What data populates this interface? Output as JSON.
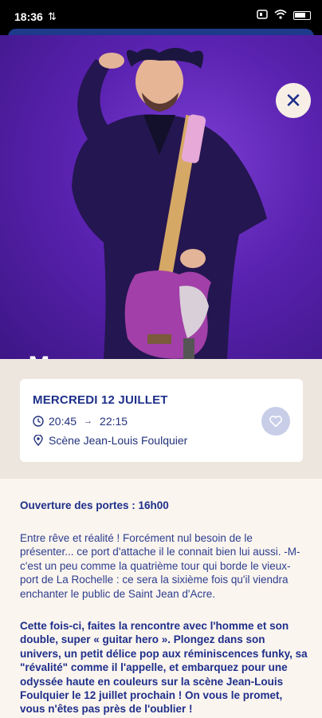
{
  "status_bar": {
    "time": "18:36",
    "data_icon": "⇅"
  },
  "hero": {
    "artist_logo": "-M-",
    "close_symbol": "✕"
  },
  "event": {
    "date": "MERCREDI 12 JUILLET",
    "start_time": "20:45",
    "arrow": "→",
    "end_time": "22:15",
    "venue": "Scène Jean-Louis Foulquier"
  },
  "details": {
    "doors": "Ouverture des portes : 16h00",
    "paragraph1": "Entre rêve et réalité ! Forcément nul besoin de le présenter... ce port d'attache il le connait bien lui aussi. -M- c'est un peu comme la quatrième tour qui borde le vieux-port de La Rochelle : ce sera la sixième fois qu'il viendra enchanter le public de Saint Jean d'Acre.",
    "paragraph2": "Cette fois-ci, faites la rencontre avec l'homme et son double, super « guitar hero ». Plongez dans son univers, un petit délice pop aux réminiscences funky, sa \"révalité\" comme il l'appelle, et embarquez pour une odyssée haute en couleurs sur la scène Jean-Louis Foulquier le 12 juillet prochain ! On vous le promet, vous n'êtes pas près de l'oublier !"
  },
  "colors": {
    "primary": "#1e2f8a",
    "hero_purple": "#5a22b0",
    "card_bg": "#ffffff",
    "info_bg": "#ede6df",
    "content_bg": "#fbf5ef"
  }
}
